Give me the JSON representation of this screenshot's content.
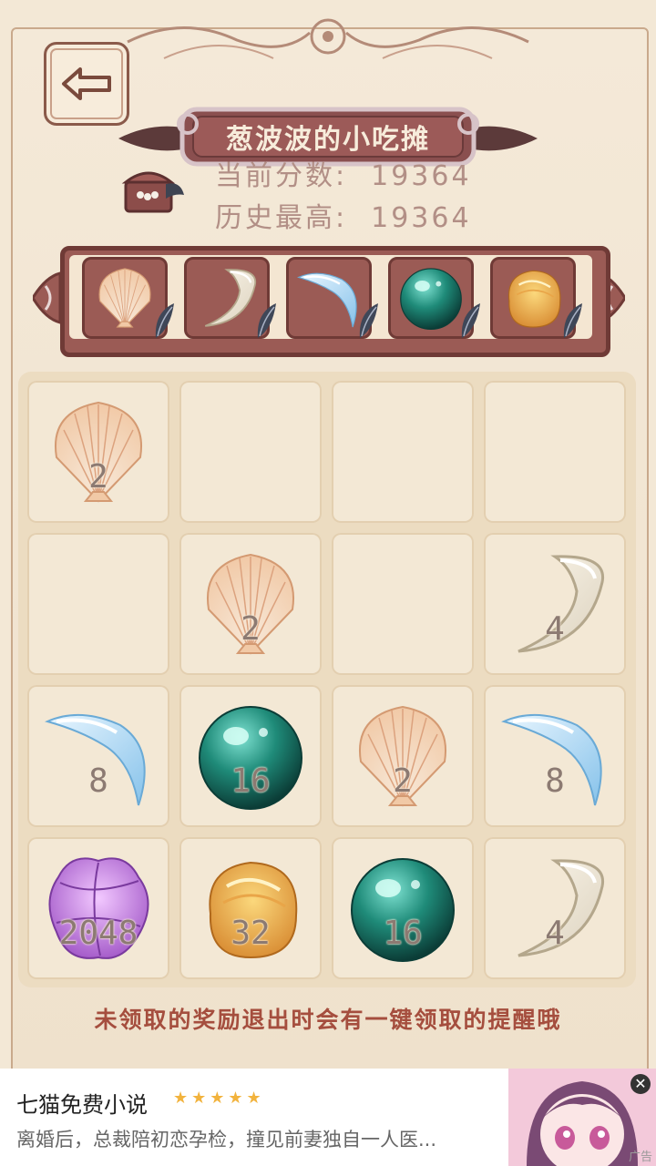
{
  "header": {
    "title": "葱波波的小吃摊",
    "current_score_label": "当前分数:",
    "current_score_value": "19364",
    "best_score_label": "历史最高:",
    "best_score_value": "19364"
  },
  "tray": {
    "items": [
      "scallop-shell",
      "white-claw",
      "blue-tusk",
      "teal-pearl",
      "amber-stone"
    ]
  },
  "board": {
    "rows": [
      [
        {
          "item": "scallop-shell",
          "value": "2"
        },
        null,
        null,
        null
      ],
      [
        null,
        {
          "item": "scallop-shell",
          "value": "2"
        },
        null,
        {
          "item": "white-claw",
          "value": "4"
        }
      ],
      [
        {
          "item": "blue-tusk",
          "value": "8"
        },
        {
          "item": "teal-pearl",
          "value": "16"
        },
        {
          "item": "scallop-shell",
          "value": "2"
        },
        {
          "item": "blue-tusk",
          "value": "8"
        }
      ],
      [
        {
          "item": "purple-flower",
          "value": "2048"
        },
        {
          "item": "amber-stone",
          "value": "32"
        },
        {
          "item": "teal-pearl",
          "value": "16"
        },
        {
          "item": "white-claw",
          "value": "4"
        }
      ]
    ]
  },
  "tip": "未领取的奖励退出时会有一键领取的提醒哦",
  "ad": {
    "title": "七猫免费小说",
    "stars": "★★★★★",
    "description": "离婚后，总裁陪初恋孕检，撞见前妻独自一人医...",
    "close_symbol": "✕",
    "label": "广告"
  },
  "colors": {
    "accent": "#9b5b55",
    "tip_text": "#a54e3e",
    "background": "#f3e8d6"
  }
}
